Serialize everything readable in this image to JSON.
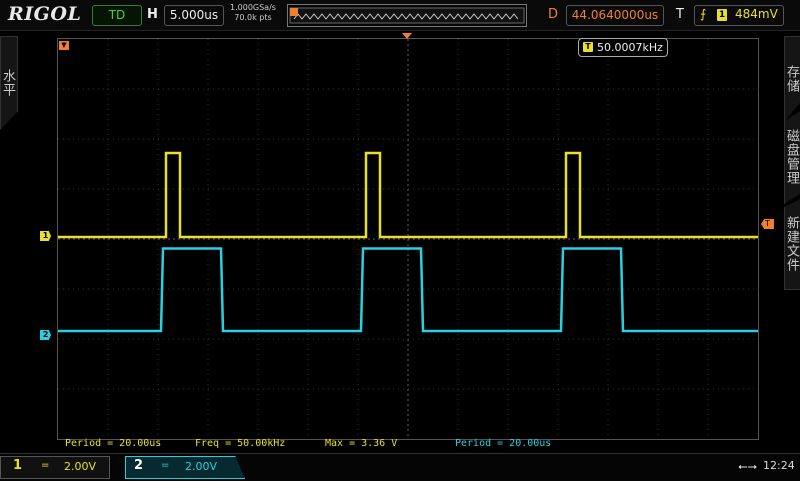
{
  "brand": "RIGOL",
  "toolbar": {
    "mode": "TD",
    "horizontal_label": "H",
    "timebase": "5.000us",
    "sample_rate": "1.000GSa/s",
    "memory_depth": "70.0k pts",
    "delay_label": "D",
    "delay": "44.0640000us",
    "trigger_label": "T",
    "trigger_source": "1",
    "trigger_level": "484mV"
  },
  "side_menu": {
    "horizontal": "水平",
    "storage": "存储",
    "disk_management": "磁盘管理",
    "new_file": "新建文件"
  },
  "counter": {
    "channel": "T",
    "frequency": "50.0007kHz"
  },
  "markers": {
    "ch1": "1",
    "ch2": "2",
    "trigger": "T"
  },
  "measurements": [
    "Period = 20.00us",
    "Freq = 50.00kHz",
    "Max = 3.36 V",
    "Period = 20.00us"
  ],
  "channels": [
    {
      "number": "1",
      "coupling": "=",
      "scale": "2.00V",
      "color": "#e8e02a"
    },
    {
      "number": "2",
      "coupling": "=",
      "scale": "2.00V",
      "color": "#28d0e0"
    }
  ],
  "status": {
    "usb_icon": "usb-icon",
    "time": "12:24"
  },
  "chart_data": {
    "type": "line",
    "x_unit": "us",
    "y_unit": "V",
    "series": [
      {
        "color": "#e8e02a",
        "x": [
          0,
          10.8,
          10.8,
          12.2,
          12.2,
          30.8,
          30.8,
          32.2,
          32.2,
          50.8,
          50.8,
          52.2,
          52.2,
          70
        ],
        "y": [
          0,
          0,
          3.36,
          3.36,
          0,
          0,
          3.36,
          3.36,
          0,
          0,
          3.36,
          3.36,
          0,
          0
        ]
      },
      {
        "color": "#28d0e0",
        "x": [
          0,
          10.3,
          10.5,
          16.3,
          16.5,
          30.3,
          30.5,
          36.3,
          36.5,
          50.3,
          50.5,
          56.3,
          56.5,
          70
        ],
        "y": [
          0,
          0,
          3.3,
          3.3,
          0,
          0,
          3.3,
          3.3,
          0,
          0,
          3.3,
          3.3,
          0,
          0
        ]
      }
    ]
  }
}
